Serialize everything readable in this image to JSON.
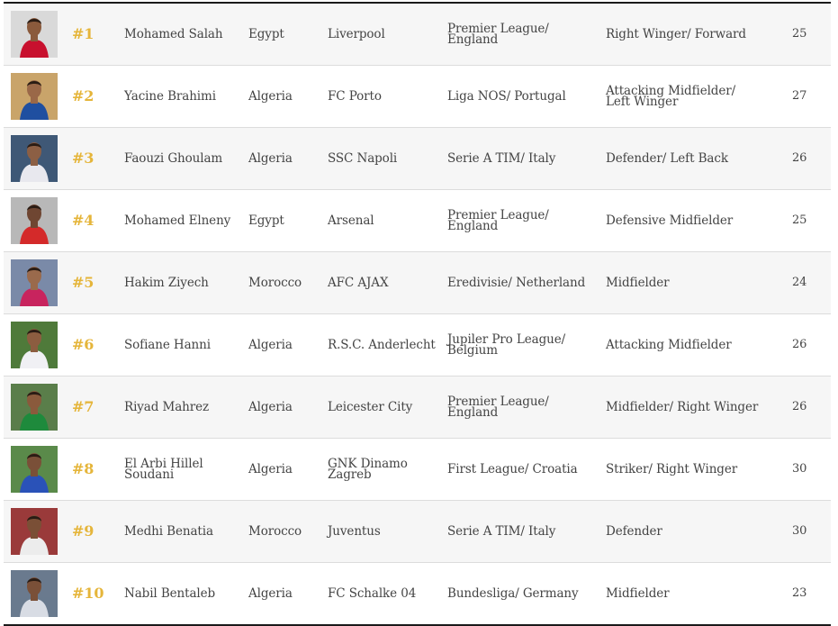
{
  "players": [
    {
      "rank": "#1",
      "name": "Mohamed Salah",
      "country": "Egypt",
      "club": "Liverpool",
      "league": "Premier League/ England",
      "position": "Right Winger/ Forward",
      "age": "25",
      "jersey": "#c8102e",
      "skin": "#8a5a3c",
      "bg": "#d9d9d9"
    },
    {
      "rank": "#2",
      "name": "Yacine Brahimi",
      "country": "Algeria",
      "club": "FC Porto",
      "league": "Liga NOS/ Portugal",
      "position": "Attacking Midfielder/ Left Winger",
      "age": "27",
      "jersey": "#1f4fa0",
      "skin": "#9a6848",
      "bg": "#c9a46a"
    },
    {
      "rank": "#3",
      "name": "Faouzi Ghoulam",
      "country": "Algeria",
      "club": "SSC Napoli",
      "league": "Serie A TIM/ Italy",
      "position": "Defender/ Left Back",
      "age": "26",
      "jersey": "#e8e8ee",
      "skin": "#8c5f44",
      "bg": "#3f5876"
    },
    {
      "rank": "#4",
      "name": "Mohamed Elneny",
      "country": "Egypt",
      "club": "Arsenal",
      "league": "Premier League/ England",
      "position": "Defensive Midfielder",
      "age": "25",
      "jersey": "#d42a2a",
      "skin": "#6f4632",
      "bg": "#b8b8b8"
    },
    {
      "rank": "#5",
      "name": "Hakim Ziyech",
      "country": "Morocco",
      "club": "AFC AJAX",
      "league": "Eredivisie/ Netherland",
      "position": "Midfielder",
      "age": "24",
      "jersey": "#c8245e",
      "skin": "#9a6a4c",
      "bg": "#7a8aa8"
    },
    {
      "rank": "#6",
      "name": "Sofiane Hanni",
      "country": "Algeria",
      "club": "R.S.C. Anderlecht",
      "league": "Jupiler Pro League/ Belgium",
      "position": "Attacking Midfielder",
      "age": "26",
      "jersey": "#f0f0f4",
      "skin": "#8c5d40",
      "bg": "#4f7a3a"
    },
    {
      "rank": "#7",
      "name": "Riyad Mahrez",
      "country": "Algeria",
      "club": "Leicester City",
      "league": "Premier League/ England",
      "position": "Midfielder/ Right Winger",
      "age": "26",
      "jersey": "#1e8a3c",
      "skin": "#8a5a3c",
      "bg": "#5a7e4a"
    },
    {
      "rank": "#8",
      "name": "El Arbi Hillel Soudani",
      "country": "Algeria",
      "club": "GNK Dinamo Zagreb",
      "league": "First League/ Croatia",
      "position": "Striker/ Right Winger",
      "age": "30",
      "jersey": "#2a52b8",
      "skin": "#7a5038",
      "bg": "#5a8a4a"
    },
    {
      "rank": "#9",
      "name": "Medhi Benatia",
      "country": "Morocco",
      "club": "Juventus",
      "league": "Serie A TIM/ Italy",
      "position": "Defender",
      "age": "30",
      "jersey": "#ececec",
      "skin": "#7a4f36",
      "bg": "#9a3a3a"
    },
    {
      "rank": "#10",
      "name": "Nabil Bentaleb",
      "country": "Algeria",
      "club": "FC Schalke 04",
      "league": "Bundesliga/ Germany",
      "position": "Midfielder",
      "age": "23",
      "jersey": "#d8dce4",
      "skin": "#7a5038",
      "bg": "#6a7a8e"
    }
  ]
}
